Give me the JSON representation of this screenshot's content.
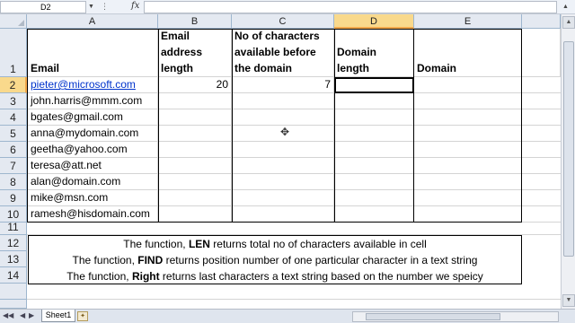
{
  "formula_bar": {
    "name_box": "D2",
    "fx_label": "fx",
    "formula": ""
  },
  "columns": [
    "A",
    "B",
    "C",
    "D",
    "E"
  ],
  "selected_column": "D",
  "rows": [
    "1",
    "2",
    "3",
    "4",
    "5",
    "6",
    "7",
    "8",
    "9",
    "10",
    "11",
    "12",
    "13",
    "14"
  ],
  "selected_row": "2",
  "headers": {
    "email": "Email",
    "email_length": "Email address length",
    "chars_before": "No of characters available before the domain",
    "domain_length": "Domain length",
    "domain": "Domain"
  },
  "emails": [
    "pieter@microsoft.com",
    "john.harris@mmm.com",
    "bgates@gmail.com",
    "anna@mydomain.com",
    "geetha@yahoo.com",
    "teresa@att.net",
    "alan@domain.com",
    "mike@msn.com",
    "ramesh@hisdomain.com"
  ],
  "row2": {
    "email_length": "20",
    "chars_before": "7"
  },
  "notes": [
    {
      "pre": "The function, ",
      "fn": "LEN",
      "post": " returns total no of characters available in cell"
    },
    {
      "pre": "The function, ",
      "fn": "FIND",
      "post": " returns position number of one particular character in a text string"
    },
    {
      "pre": "The function, ",
      "fn": "Right",
      "post": " returns last characters a text string based on the number we speicy"
    }
  ],
  "sheet_tab": "Sheet1",
  "colors": {
    "header_bg": "#e4e9f1",
    "selected_header": "#f9d98c",
    "link": "#0033cc"
  }
}
